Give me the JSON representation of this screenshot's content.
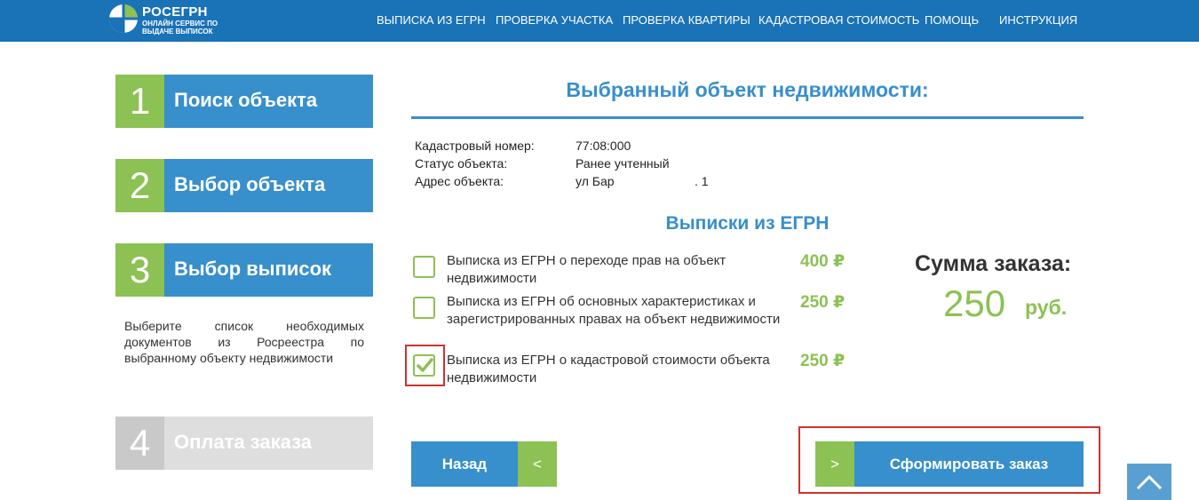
{
  "header": {
    "logo": {
      "title": "РОСЕГРН",
      "subtitle": "ОНЛАЙН СЕРВИС ПО ВЫДАЧЕ ВЫПИСОК"
    },
    "nav": [
      {
        "label": "ВЫПИСКА ИЗ ЕГРН"
      },
      {
        "label": "ПРОВЕРКА УЧАСТКА"
      },
      {
        "label": "ПРОВЕРКА КВАРТИРЫ"
      },
      {
        "label": "КАДАСТРОВАЯ СТОИМОСТЬ"
      },
      {
        "label": "ПОМОЩЬ"
      },
      {
        "label": "ИНСТРУКЦИЯ"
      }
    ]
  },
  "steps": [
    {
      "number": "1",
      "label": "Поиск объекта",
      "state": "active"
    },
    {
      "number": "2",
      "label": "Выбор объекта",
      "state": "active"
    },
    {
      "number": "3",
      "label": "Выбор выписок",
      "state": "current",
      "description": "Выберите список необходимых документов из Росреестра по выбранному объекту недвижимости"
    },
    {
      "number": "4",
      "label": "Оплата заказа",
      "state": "disabled"
    }
  ],
  "main": {
    "title": "Выбранный объект недвижимости:",
    "info": [
      {
        "key": "Кадастровый номер:",
        "value": "77:08:000"
      },
      {
        "key": "Статус объекта:",
        "value": "Ранее учтенный"
      },
      {
        "key": "Адрес объекта:",
        "value": "ул Бар"
      }
    ],
    "address_suffix": ". 1",
    "extracts_title": "Выписки из ЕГРН",
    "options": [
      {
        "label": "Выписка из ЕГРН о переходе прав на объект недвижимости",
        "price": "400 ₽",
        "checked": false
      },
      {
        "label": "Выписка из ЕГРН об основных характеристиках и зарегистрированных правах на объект недвижимости",
        "price": "250 ₽",
        "checked": false
      },
      {
        "label": "Выписка из ЕГРН о кадастровой стоимости объекта недвижимости",
        "price": "250 ₽",
        "checked": true
      }
    ],
    "summary": {
      "label": "Сумма заказа:",
      "value": "250",
      "currency": "руб."
    },
    "buttons": {
      "back_label": "Назад",
      "back_arrow": "<",
      "submit_label": "Сформировать заказ",
      "submit_arrow": ">"
    }
  },
  "colors": {
    "header_blue": "#1a72b7",
    "step_blue": "#378fcb",
    "accent_green": "#8cc153",
    "highlight_red": "#d0312d"
  }
}
